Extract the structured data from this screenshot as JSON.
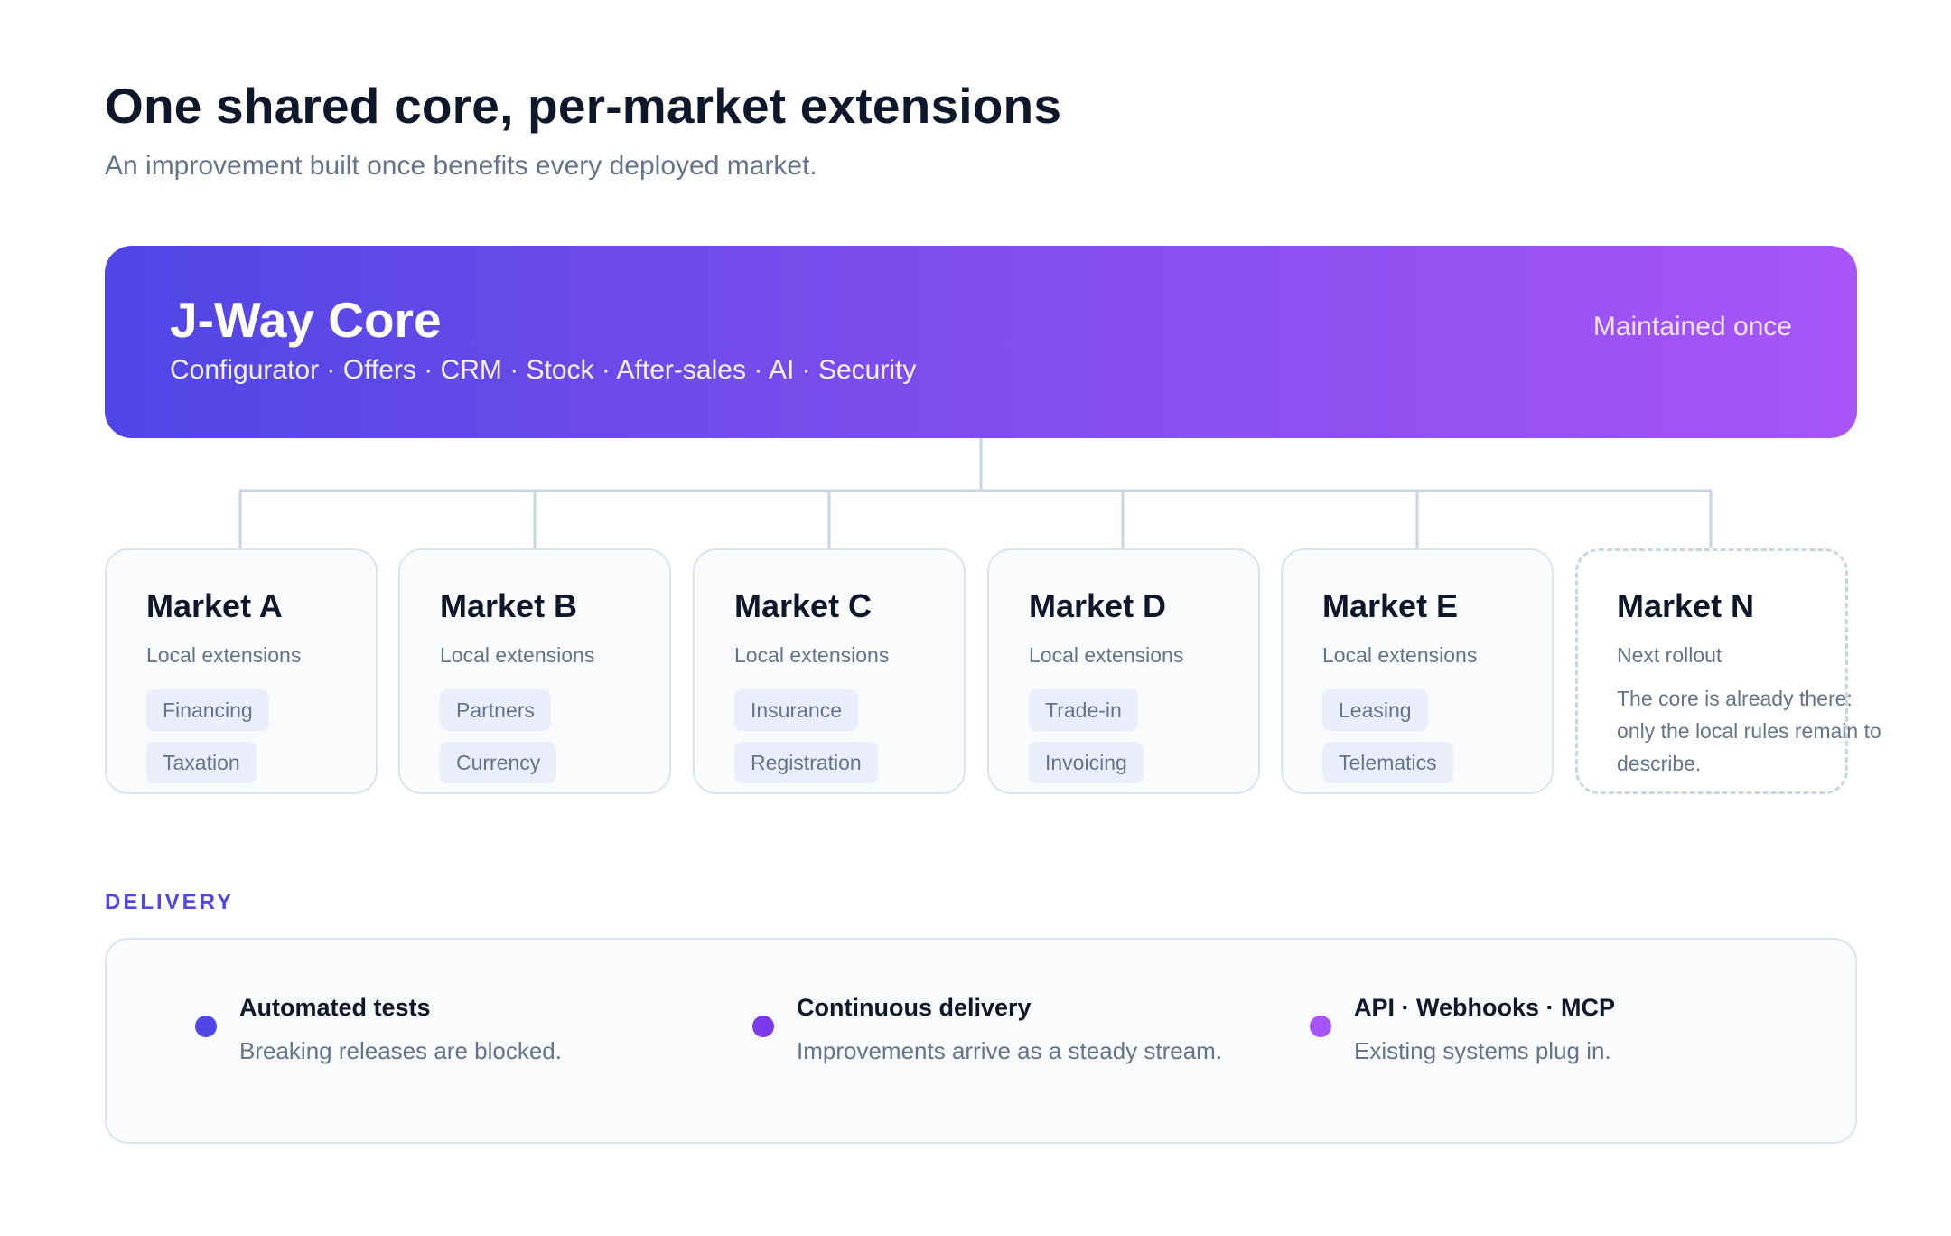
{
  "header": {
    "title": "One shared core, per-market extensions",
    "subtitle": "An improvement built once benefits every deployed market."
  },
  "core": {
    "title": "J-Way Core",
    "modules": "Configurator · Offers · CRM · Stock · After-sales · AI · Security",
    "note": "Maintained once"
  },
  "markets": [
    {
      "name": "Market A",
      "subtitle": "Local extensions",
      "chips": [
        "Financing",
        "Taxation"
      ]
    },
    {
      "name": "Market B",
      "subtitle": "Local extensions",
      "chips": [
        "Partners",
        "Currency"
      ]
    },
    {
      "name": "Market C",
      "subtitle": "Local extensions",
      "chips": [
        "Insurance",
        "Registration"
      ]
    },
    {
      "name": "Market D",
      "subtitle": "Local extensions",
      "chips": [
        "Trade-in",
        "Invoicing"
      ]
    },
    {
      "name": "Market E",
      "subtitle": "Local extensions",
      "chips": [
        "Leasing",
        "Telematics"
      ]
    },
    {
      "name": "Market N",
      "subtitle": "Next rollout",
      "description": "The core is already there: only the local rules remain to describe."
    }
  ],
  "delivery": {
    "label": "DELIVERY",
    "items": [
      {
        "title": "Automated tests",
        "description": "Breaking releases are blocked.",
        "color": "#4f46e5"
      },
      {
        "title": "Continuous delivery",
        "description": "Improvements arrive as a steady stream.",
        "color": "#7c3aed"
      },
      {
        "title": "API · Webhooks · MCP",
        "description": "Existing systems plug in.",
        "color": "#a855f7"
      }
    ]
  },
  "colors": {
    "core_gradient_start": "#4f46e5",
    "core_gradient_end": "#a855f7",
    "connector": "#cbd5e1",
    "accent": "#4f46e5"
  }
}
